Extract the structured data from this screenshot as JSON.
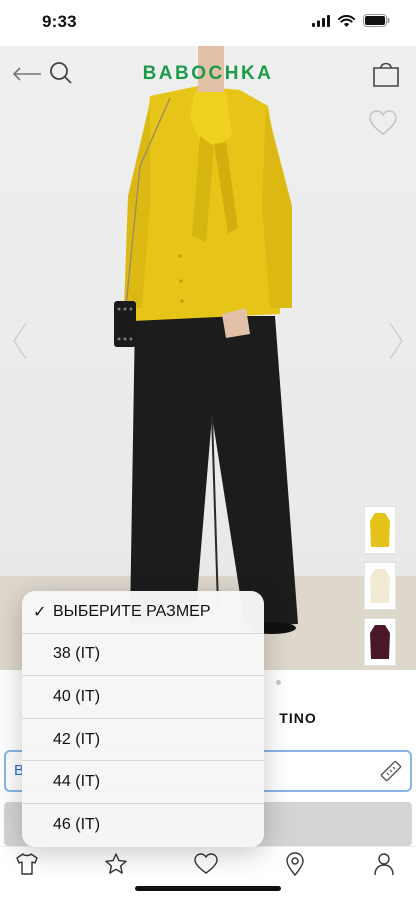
{
  "status": {
    "time": "9:33"
  },
  "header": {
    "brand": "BABOCHKA"
  },
  "product": {
    "brand_partial": "TINO"
  },
  "size_field": {
    "label_partial": "В"
  },
  "size_picker": {
    "selected_label": "ВЫБЕРИТЕ РАЗМЕР",
    "options": [
      "38 (IT)",
      "40 (IT)",
      "42 (IT)",
      "44 (IT)",
      "46 (IT)"
    ]
  },
  "icons": {
    "back": "back-arrow-icon",
    "search": "search-icon",
    "bag": "shopping-bag-icon",
    "favorite": "heart-outline-icon",
    "ruler": "ruler-icon",
    "tabs": [
      "shirt-icon",
      "star-icon",
      "heart-icon",
      "location-pin-icon",
      "person-icon"
    ]
  },
  "colors": {
    "brand": "#1c9b4a",
    "field_border": "#8ab4e8",
    "field_text": "#2f6fd0"
  }
}
